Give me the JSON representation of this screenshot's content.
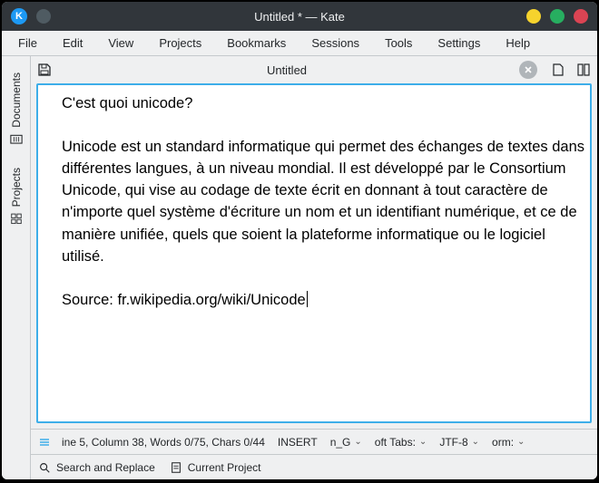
{
  "window": {
    "title": "Untitled * — Kate"
  },
  "menu": {
    "file": "File",
    "edit": "Edit",
    "view": "View",
    "projects": "Projects",
    "bookmarks": "Bookmarks",
    "sessions": "Sessions",
    "tools": "Tools",
    "settings": "Settings",
    "help": "Help"
  },
  "side": {
    "documents": "Documents",
    "projects": "Projects"
  },
  "tab": {
    "name": "Untitled"
  },
  "text": {
    "l1": "C'est quoi unicode?",
    "l2": "",
    "l3": "Unicode est un standard informatique qui permet des échanges de textes dans différentes langues, à un niveau mondial. Il est développé par le Consortium Unicode, qui vise au codage de texte écrit en donnant à tout caractère de n'importe quel système d'écriture un nom et un identifiant numérique, et ce de manière unifiée, quels que soient la plateforme informatique ou le logiciel utilisé.",
    "l4": "",
    "l5": "Source: fr.wikipedia.org/wiki/Unicode"
  },
  "status": {
    "position": "ine 5, Column 38, Words 0/75, Chars 0/44",
    "mode": "INSERT",
    "lang": "n_G",
    "tabs": "oft Tabs:",
    "enc": "JTF-8",
    "eol": "orm:"
  },
  "bottom": {
    "search": "Search and Replace",
    "project": "Current Project"
  }
}
